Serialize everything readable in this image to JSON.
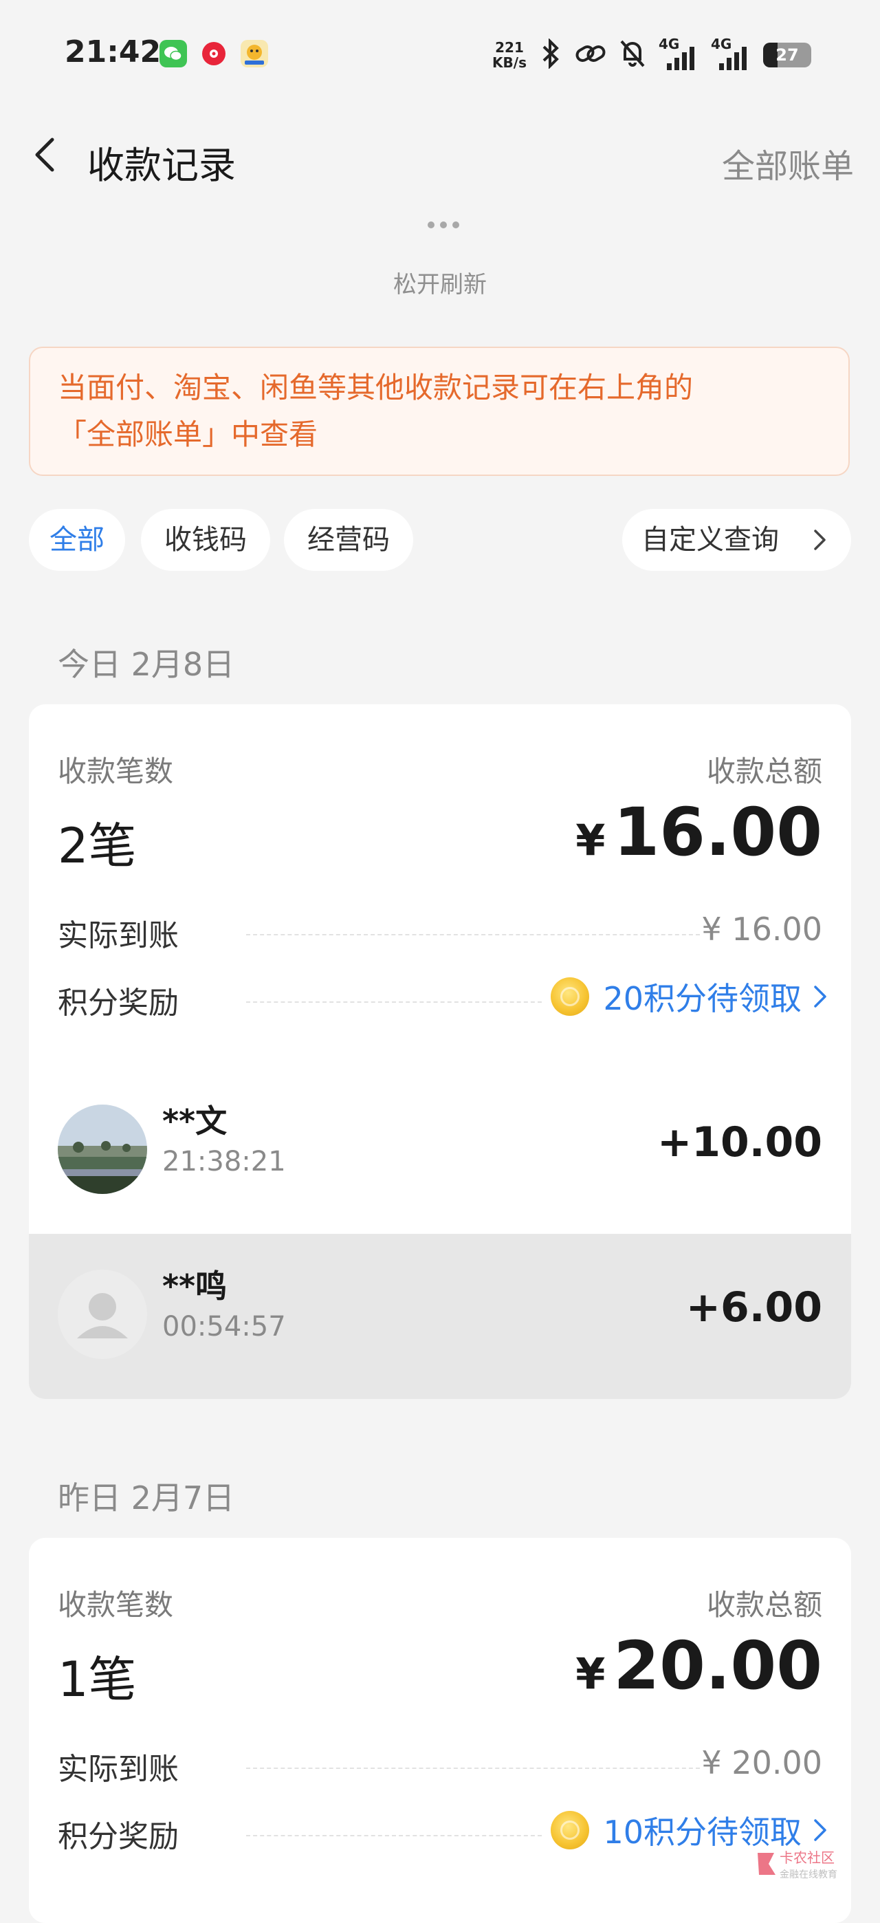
{
  "status_bar": {
    "time": "21:42",
    "speed_value": "221",
    "speed_unit": "KB/s",
    "network_1": "4G",
    "network_2": "4G",
    "battery": "27",
    "icons": [
      "wechat-icon",
      "music-icon",
      "game-app-icon",
      "bluetooth-icon",
      "link-icon",
      "mute-bell-icon",
      "signal-icon",
      "signal-icon",
      "battery-icon"
    ]
  },
  "header": {
    "title": "收款记录",
    "right_link": "全部账单"
  },
  "pull_refresh": {
    "text": "松开刷新"
  },
  "notice": {
    "line1": "当面付、淘宝、闲鱼等其他收款记录可在右上角的",
    "line2": "「全部账单」中查看"
  },
  "filters": {
    "tabs": [
      {
        "label": "全部",
        "active": true
      },
      {
        "label": "收钱码",
        "active": false
      },
      {
        "label": "经营码",
        "active": false
      }
    ],
    "custom": "自定义查询"
  },
  "groups": [
    {
      "date": "今日 2月8日",
      "count_label": "收款笔数",
      "total_label": "收款总额",
      "count": "2笔",
      "currency": "¥",
      "total": "16.00",
      "received_label": "实际到账",
      "received": "¥ 16.00",
      "points_label": "积分奖励",
      "points": "20积分待领取",
      "transactions": [
        {
          "name": "**文",
          "time": "21:38:21",
          "amount": "+10.00",
          "avatar": "landscape-photo"
        },
        {
          "name": "**鸣",
          "time": "00:54:57",
          "amount": "+6.00",
          "avatar": "default-user"
        }
      ]
    },
    {
      "date": "昨日 2月7日",
      "count_label": "收款笔数",
      "total_label": "收款总额",
      "count": "1笔",
      "currency": "¥",
      "total": "20.00",
      "received_label": "实际到账",
      "received": "¥ 20.00",
      "points_label": "积分奖励",
      "points": "10积分待领取"
    }
  ],
  "watermark": {
    "line1": "卡农社区",
    "line2": "金融在线教育"
  },
  "colors": {
    "accent_blue": "#2f7ee8",
    "notice_orange": "#e5692c",
    "notice_bg": "#fff6f1",
    "page_bg": "#f4f4f4"
  }
}
